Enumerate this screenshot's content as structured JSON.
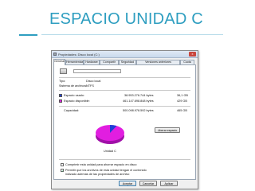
{
  "slide": {
    "title": "ESPACIO UNIDAD C"
  },
  "dialog": {
    "title": "Propiedades: Disco local (C:)",
    "close_label": "x",
    "tabs": [
      "General",
      "Herramientas",
      "Hardware",
      "Compartir",
      "Seguridad",
      "Versiones anteriores",
      "Cuota"
    ],
    "active_tab": "General",
    "name_value": "",
    "type_label": "Tipo:",
    "type_value": "Disco local",
    "fs_label": "Sistema de archivos:",
    "fs_value": "NTFS",
    "used": {
      "label": "Espacio usado:",
      "bytes": "38.953.276.744 bytes",
      "size": "36,1 GB",
      "color": "#1f3fd6"
    },
    "free": {
      "label": "Espacio disponible:",
      "bytes": "461.147.698.848 bytes",
      "size": "429 GB",
      "color": "#e11ee0"
    },
    "capacity": {
      "label": "Capacidad:",
      "bytes": "500.098.978.592 bytes",
      "size": "465 GB"
    },
    "pie": {
      "used_fraction": 0.078,
      "used_color": "#1f3fd6",
      "free_color": "#e11ee0"
    },
    "drive_label": "Unidad C",
    "free_space_button": "Liberar espacio",
    "compress_label": "Comprimir esta unidad para ahorrar espacio en disco",
    "index_label_1": "Permitir que los archivos de esta unidad tengan el contenido",
    "index_label_2": "indizado además de las propiedades de archivo",
    "buttons": {
      "accept": "Aceptar",
      "cancel": "Cancelar",
      "apply": "Aplicar"
    }
  }
}
